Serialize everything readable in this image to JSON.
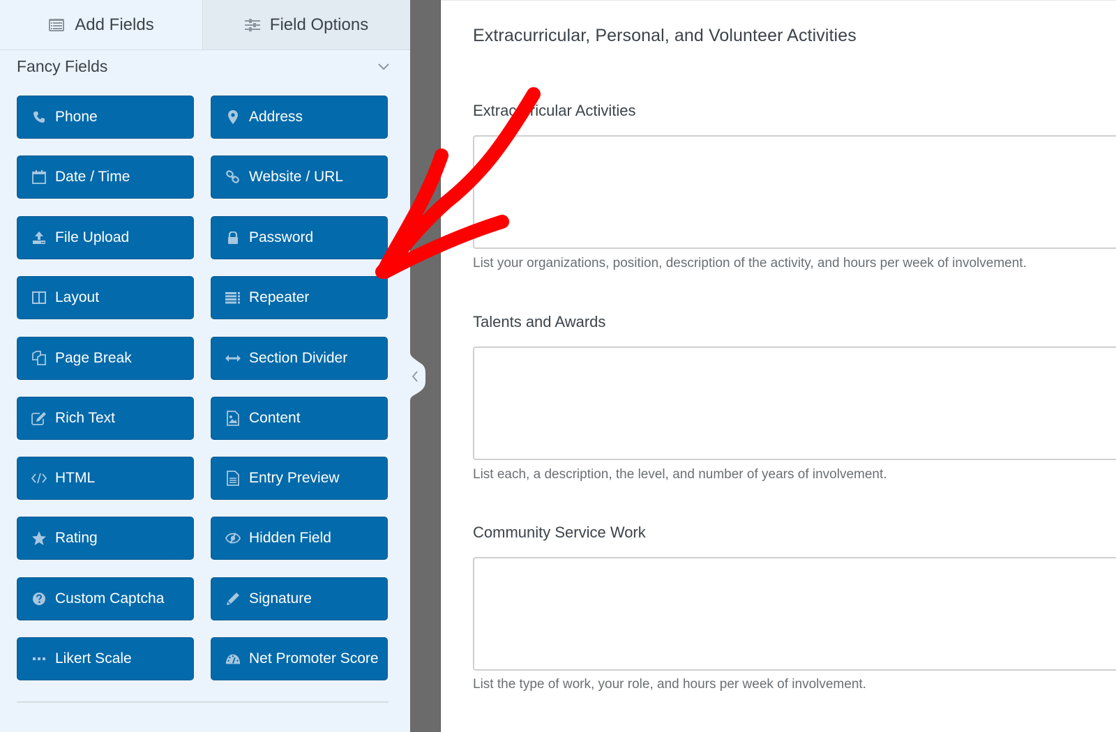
{
  "sidebar": {
    "tabs": [
      {
        "label": "Add Fields",
        "icon": "list-icon",
        "active": true
      },
      {
        "label": "Field Options",
        "icon": "sliders-icon",
        "active": false
      }
    ],
    "section": {
      "title": "Fancy Fields",
      "collapse_icon": "chevron-down-icon"
    },
    "fields": [
      {
        "label": "Phone",
        "icon": "phone-icon"
      },
      {
        "label": "Address",
        "icon": "map-marker-icon"
      },
      {
        "label": "Date / Time",
        "icon": "calendar-icon"
      },
      {
        "label": "Website / URL",
        "icon": "link-icon"
      },
      {
        "label": "File Upload",
        "icon": "upload-icon"
      },
      {
        "label": "Password",
        "icon": "lock-icon"
      },
      {
        "label": "Layout",
        "icon": "columns-icon"
      },
      {
        "label": "Repeater",
        "icon": "repeater-icon"
      },
      {
        "label": "Page Break",
        "icon": "copy-pages-icon"
      },
      {
        "label": "Section Divider",
        "icon": "arrows-horizontal-icon"
      },
      {
        "label": "Rich Text",
        "icon": "edit-icon"
      },
      {
        "label": "Content",
        "icon": "image-file-icon"
      },
      {
        "label": "HTML",
        "icon": "code-icon"
      },
      {
        "label": "Entry Preview",
        "icon": "document-icon"
      },
      {
        "label": "Rating",
        "icon": "star-icon"
      },
      {
        "label": "Hidden Field",
        "icon": "eye-slash-icon"
      },
      {
        "label": "Custom Captcha",
        "icon": "question-circle-icon"
      },
      {
        "label": "Signature",
        "icon": "pencil-icon"
      },
      {
        "label": "Likert Scale",
        "icon": "ellipsis-icon"
      },
      {
        "label": "Net Promoter Score",
        "icon": "gauge-icon"
      }
    ]
  },
  "gutter": {
    "collapse_icon": "chevron-left-icon"
  },
  "form": {
    "title": "Extracurricular, Personal, and Volunteer Activities",
    "fields": [
      {
        "label": "Extracurricular Activities",
        "value": "",
        "description": "List your organizations, position, description of the activity, and hours per week of involvement."
      },
      {
        "label": "Talents and Awards",
        "value": "",
        "description": "List each, a description, the level, and number of years of involvement."
      },
      {
        "label": "Community Service Work",
        "value": "",
        "description": "List the type of work, your role, and hours per week of involvement."
      }
    ]
  },
  "annotation": {
    "type": "arrow",
    "color": "#ff0000",
    "points_to": "Repeater"
  },
  "colors": {
    "button_bg": "#036aab",
    "sidebar_bg": "#ebf3fc",
    "gutter_bg": "#6b6b6b",
    "text_dark": "#3c434a",
    "text_muted": "#6b6f73",
    "annotation_red": "#ff0000"
  }
}
